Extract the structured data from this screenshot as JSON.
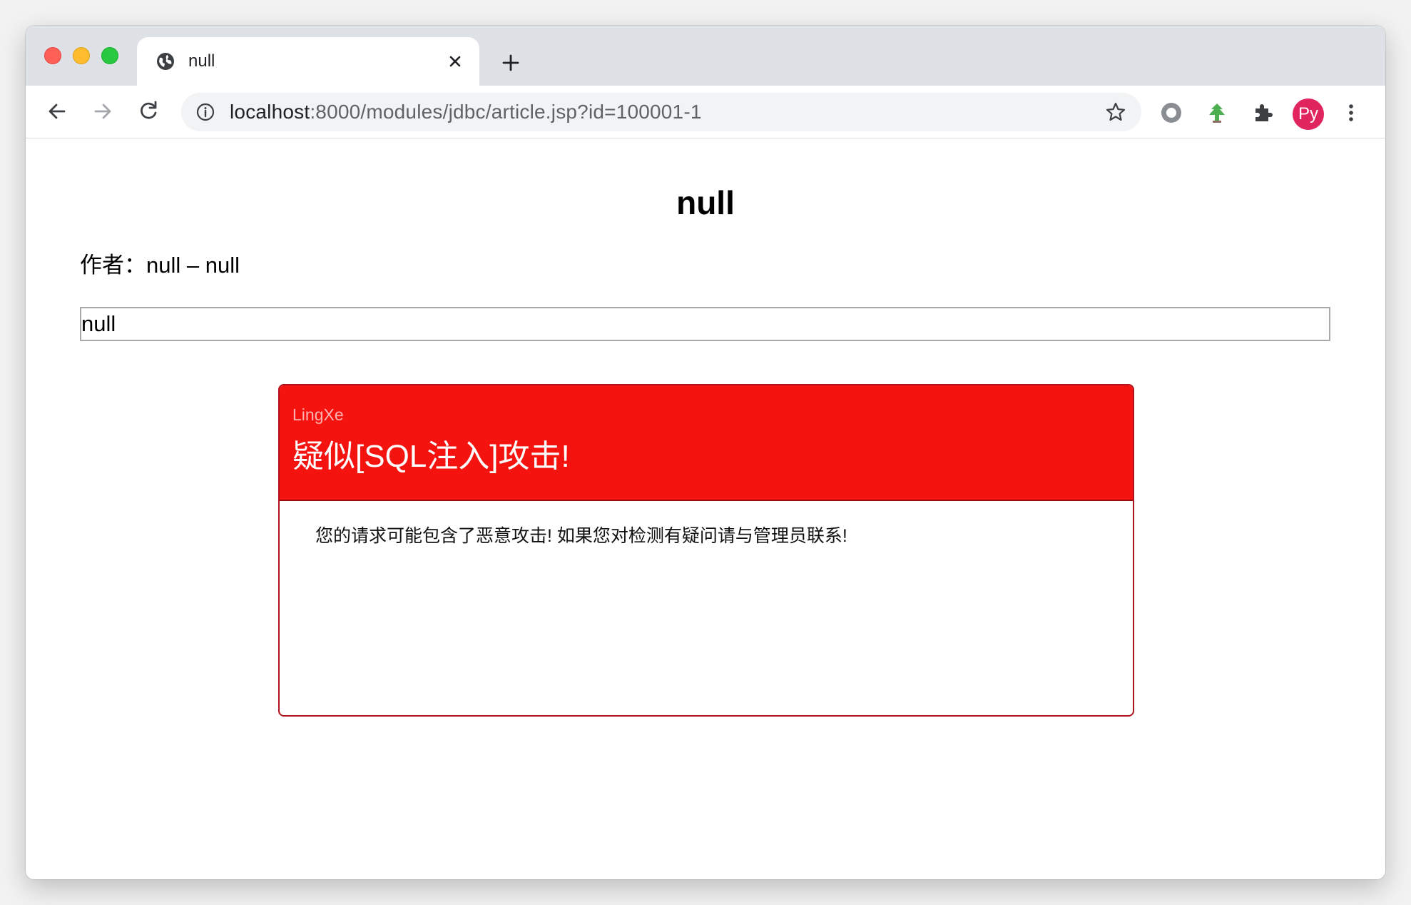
{
  "browser": {
    "tab": {
      "title": "null"
    },
    "address_bar": {
      "host": "localhost",
      "rest": ":8000/modules/jdbc/article.jsp?id=100001-1"
    },
    "profile": {
      "initials": "Py",
      "color": "#e0245e"
    },
    "icons": {
      "favicon": "globe-icon",
      "close": "close-icon",
      "new_tab": "plus-icon",
      "back": "arrow-left-icon",
      "forward": "arrow-right-icon",
      "reload": "reload-icon",
      "info": "info-icon",
      "bookmark": "star-icon",
      "extension_1": "record-icon",
      "extension_2": "tree-icon",
      "extensions": "puzzle-icon",
      "menu": "kebab-menu-icon"
    }
  },
  "page": {
    "title": "null",
    "author_line": "作者：null – null",
    "article_field": {
      "value": "null"
    }
  },
  "waf_alert": {
    "brand": "LingXe",
    "title": "疑似[SQL注入]攻击!",
    "message": "您的请求可能包含了恶意攻击! 如果您对检测有疑问请与管理员联系!",
    "header_color": "#f5130f",
    "border_color": "#b0131d"
  }
}
